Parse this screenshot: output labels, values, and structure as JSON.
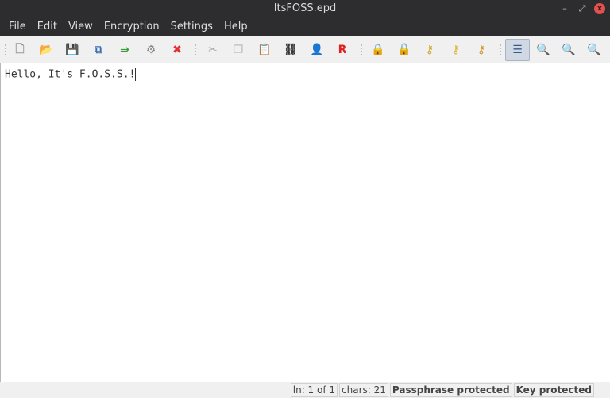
{
  "window": {
    "title": "ItsFOSS.epd"
  },
  "menu": [
    "File",
    "Edit",
    "View",
    "Encryption",
    "Settings",
    "Help"
  ],
  "toolbar": [
    {
      "name": "new-icon",
      "glyph": "🗋",
      "color": "#999"
    },
    {
      "name": "open-icon",
      "glyph": "📂",
      "color": "#e0a030"
    },
    {
      "name": "save-icon",
      "glyph": "💾",
      "color": "#3a6fb0"
    },
    {
      "name": "save-as-icon",
      "glyph": "⧉",
      "color": "#3a6fb0"
    },
    {
      "name": "export-icon",
      "glyph": "⇛",
      "color": "#3a9a3a"
    },
    {
      "name": "properties-icon",
      "glyph": "⚙",
      "color": "#888"
    },
    {
      "name": "close-file-icon",
      "glyph": "✖",
      "color": "#e03030"
    },
    {
      "name": "cut-icon",
      "glyph": "✂",
      "color": "#aaa"
    },
    {
      "name": "copy-icon",
      "glyph": "❐",
      "color": "#bbb"
    },
    {
      "name": "paste-icon",
      "glyph": "📋",
      "color": "#c08a40"
    },
    {
      "name": "find-icon",
      "glyph": "⛓",
      "color": "#333"
    },
    {
      "name": "user-icon",
      "glyph": "👤",
      "color": "#c06030"
    },
    {
      "name": "replace-icon",
      "glyph": "R",
      "color": "#e02020"
    },
    {
      "name": "lock-icon",
      "glyph": "🔒",
      "color": "#d0a020"
    },
    {
      "name": "unlock-icon",
      "glyph": "🔓",
      "color": "#d08020"
    },
    {
      "name": "key-add-icon",
      "glyph": "⚷",
      "color": "#d0a020"
    },
    {
      "name": "key-icon",
      "glyph": "⚷",
      "color": "#e0b020"
    },
    {
      "name": "key-remove-icon",
      "glyph": "⚷",
      "color": "#d09020"
    },
    {
      "name": "word-wrap-icon",
      "glyph": "☰",
      "color": "#3a5a8a"
    },
    {
      "name": "zoom-in-icon",
      "glyph": "🔍",
      "color": "#3a9a3a"
    },
    {
      "name": "zoom-out-icon",
      "glyph": "🔍",
      "color": "#d04040"
    },
    {
      "name": "zoom-reset-icon",
      "glyph": "🔍",
      "color": "#3a6fb0"
    }
  ],
  "editor": {
    "content": "Hello, It's F.O.S.S.!"
  },
  "status": {
    "line": "ln: 1 of 1",
    "chars": "chars: 21",
    "passphrase": "Passphrase protected",
    "key": "Key protected"
  }
}
